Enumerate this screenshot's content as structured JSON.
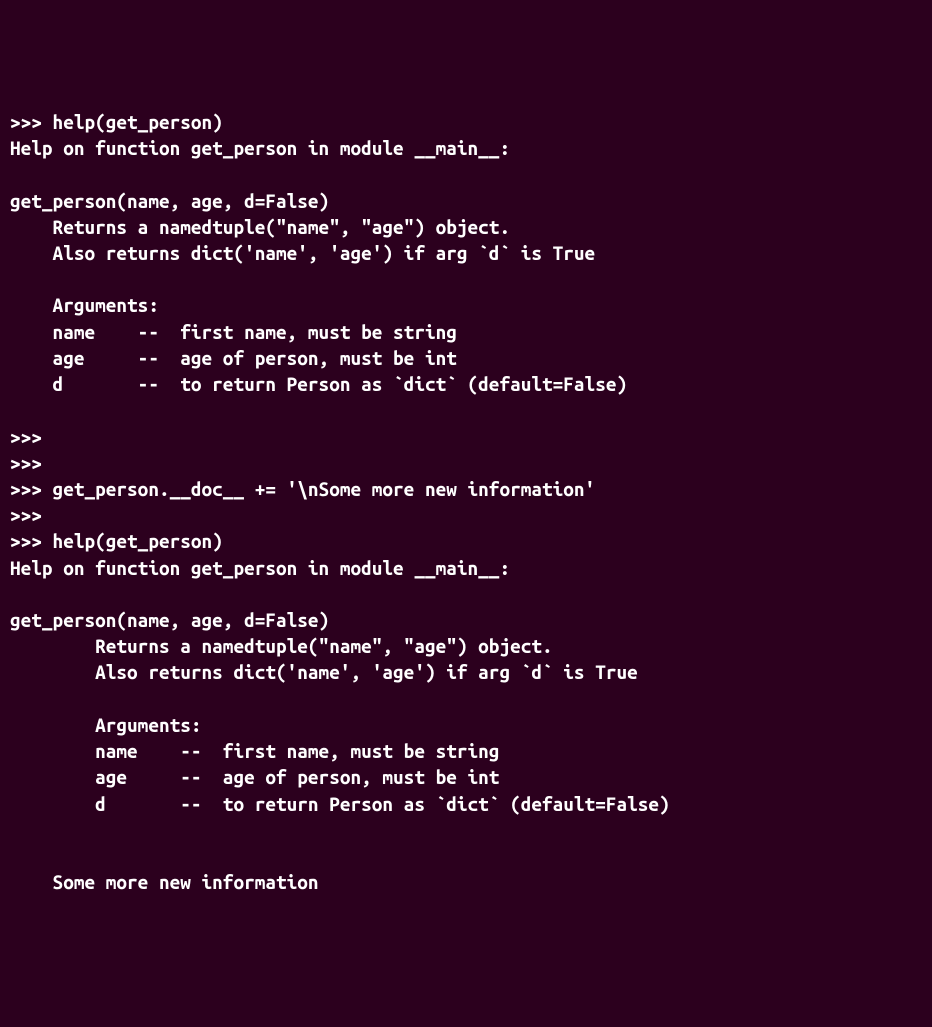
{
  "terminal": {
    "lines": [
      ">>> help(get_person)",
      "Help on function get_person in module __main__:",
      "",
      "get_person(name, age, d=False)",
      "    Returns a namedtuple(\"name\", \"age\") object.",
      "    Also returns dict('name', 'age') if arg `d` is True",
      "",
      "    Arguments:",
      "    name    --  first name, must be string",
      "    age     --  age of person, must be int",
      "    d       --  to return Person as `dict` (default=False)",
      "",
      ">>>",
      ">>>",
      ">>> get_person.__doc__ += '\\nSome more new information'",
      ">>>",
      ">>> help(get_person)",
      "Help on function get_person in module __main__:",
      "",
      "get_person(name, age, d=False)",
      "        Returns a namedtuple(\"name\", \"age\") object.",
      "        Also returns dict('name', 'age') if arg `d` is True",
      "",
      "        Arguments:",
      "        name    --  first name, must be string",
      "        age     --  age of person, must be int",
      "        d       --  to return Person as `dict` (default=False)",
      "",
      "",
      "    Some more new information"
    ]
  }
}
